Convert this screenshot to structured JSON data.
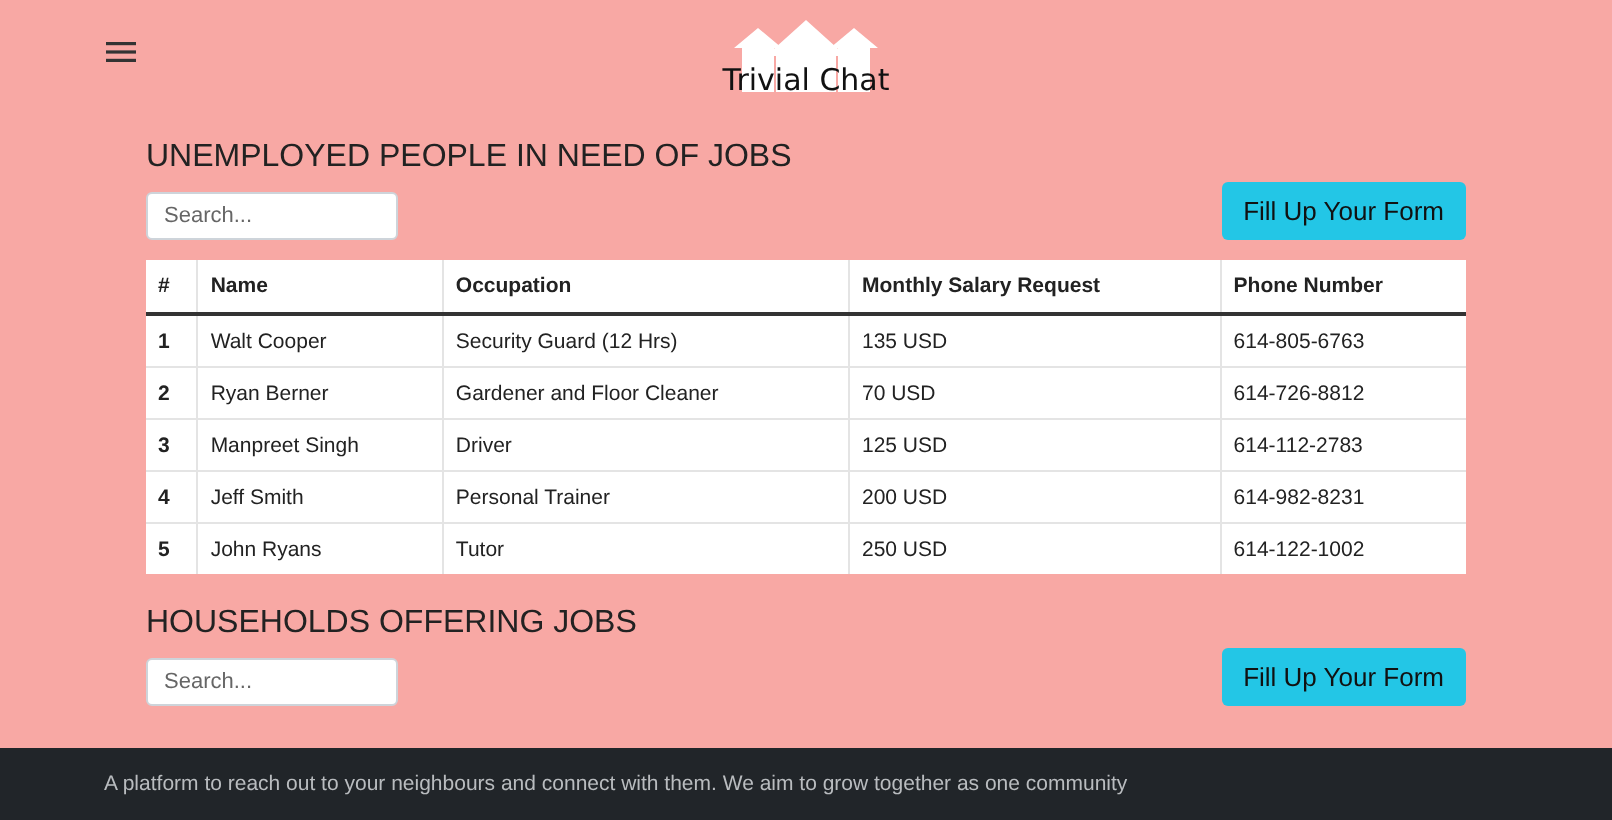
{
  "header": {
    "brand": "Trivial Chat"
  },
  "sections": [
    {
      "title": "UNEMPLOYED PEOPLE IN NEED OF JOBS",
      "search": {
        "placeholder": "Search..."
      },
      "button": "Fill Up Your Form",
      "table": {
        "columns": [
          "#",
          "Name",
          "Occupation",
          "Monthly Salary Request",
          "Phone Number"
        ],
        "rows": [
          [
            "1",
            "Walt Cooper",
            "Security Guard (12 Hrs)",
            "135 USD",
            "614-805-6763"
          ],
          [
            "2",
            "Ryan Berner",
            "Gardener and Floor Cleaner",
            "70 USD",
            "614-726-8812"
          ],
          [
            "3",
            "Manpreet Singh",
            "Driver",
            "125 USD",
            "614-112-2783"
          ],
          [
            "4",
            "Jeff Smith",
            "Personal Trainer",
            "200 USD",
            "614-982-8231"
          ],
          [
            "5",
            "John Ryans",
            "Tutor",
            "250 USD",
            "614-122-1002"
          ]
        ]
      }
    },
    {
      "title": "HOUSEHOLDS OFFERING JOBS",
      "search": {
        "placeholder": "Search..."
      },
      "button": "Fill Up Your Form"
    }
  ],
  "footer": {
    "text": "A platform to reach out to your neighbours and connect with them. We aim to grow together as one community"
  }
}
